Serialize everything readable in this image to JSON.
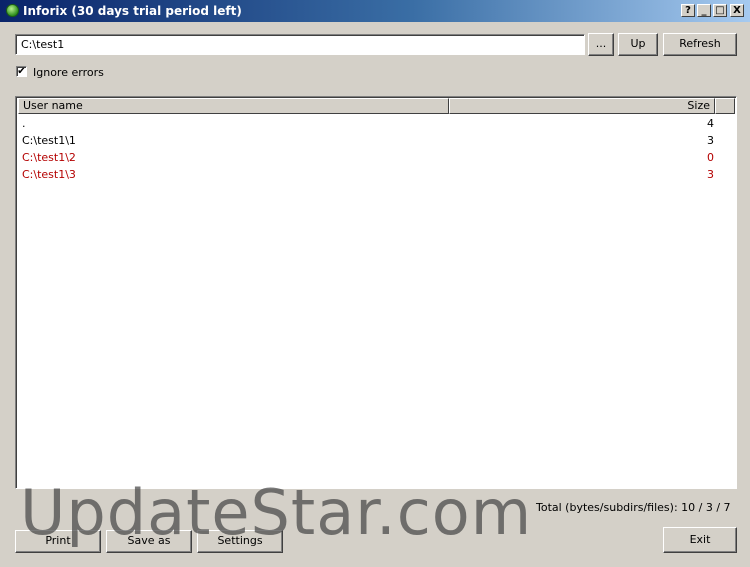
{
  "window": {
    "title": "Inforix (30 days trial period left)"
  },
  "titlebar_buttons": {
    "help": "?",
    "minimize": "_",
    "maximize": "□",
    "close": "X"
  },
  "path": {
    "value": "C:\\test1"
  },
  "toolbar": {
    "browse_label": "...",
    "up_label": "Up",
    "refresh_label": "Refresh"
  },
  "options": {
    "ignore_errors_label": "Ignore errors",
    "ignore_errors_checked": true,
    "check_glyph": "✔"
  },
  "list": {
    "columns": [
      "User name",
      "Size"
    ],
    "rows": [
      {
        "name": ".",
        "size": "4",
        "error": false
      },
      {
        "name": "C:\\test1\\1",
        "size": "3",
        "error": false
      },
      {
        "name": "C:\\test1\\2",
        "size": "0",
        "error": true
      },
      {
        "name": "C:\\test1\\3",
        "size": "3",
        "error": true
      }
    ]
  },
  "status": {
    "total": "Total (bytes/subdirs/files): 10 / 3 / 7"
  },
  "footer": {
    "print_label": "Print",
    "saveas_label": "Save as",
    "settings_label": "Settings",
    "exit_label": "Exit"
  },
  "watermark": "UpdateStar.com",
  "colors": {
    "error_text": "#b40000",
    "titlebar_start": "#0a246a",
    "titlebar_end": "#a6caf0",
    "face": "#d4d0c8"
  },
  "icons": {
    "app": "app-icon"
  }
}
